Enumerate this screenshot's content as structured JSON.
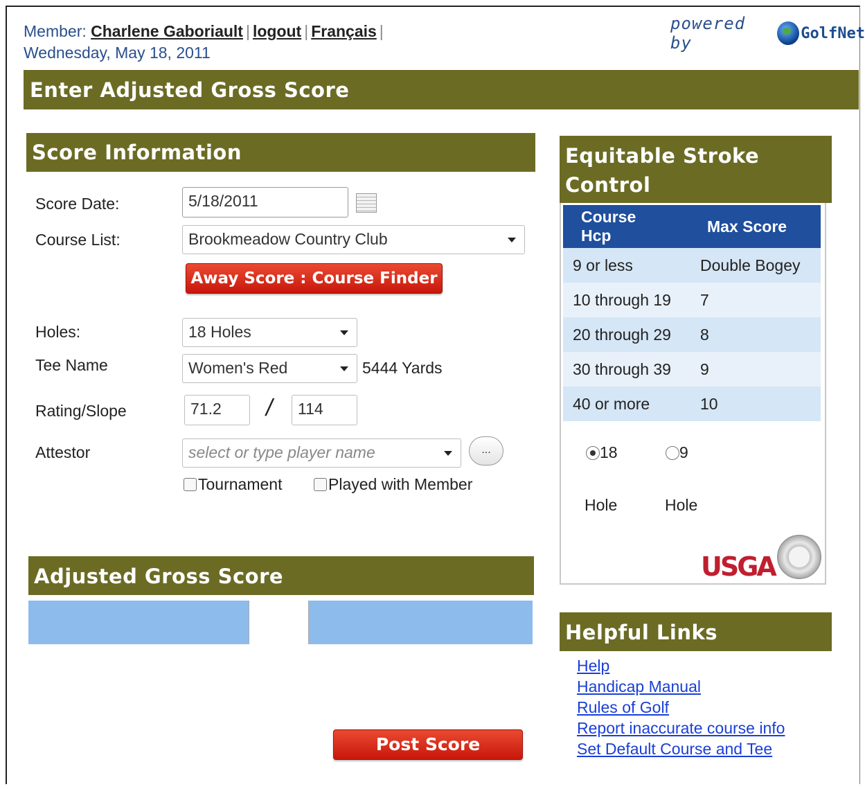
{
  "header": {
    "member_label": "Member:",
    "member_name": "Charlene Gaboriault",
    "logout": "logout",
    "language": "Français",
    "date": "Wednesday, May 18, 2011",
    "powered_by": "powered by",
    "brand": "GolfNet"
  },
  "page_title": "Enter Adjusted Gross Score",
  "score_info": {
    "title": "Score Information",
    "score_date_label": "Score Date:",
    "score_date_value": "5/18/2011",
    "course_list_label": "Course List:",
    "course_list_value": "Brookmeadow Country Club",
    "away_button": "Away Score : Course Finder",
    "holes_label": "Holes:",
    "holes_value": "18 Holes",
    "tee_label": "Tee Name",
    "tee_value": "Women's Red",
    "yards": "5444 Yards",
    "rating_label": "Rating/Slope",
    "rating_value": "71.2",
    "slash": "/",
    "slope_value": "114",
    "attestor_label": "Attestor",
    "attestor_placeholder": "select or type player name",
    "attestor_more": "...",
    "tournament_label": "Tournament",
    "played_with_label": "Played with Member"
  },
  "ags": {
    "title": "Adjusted Gross Score",
    "value": ""
  },
  "post_button": "Post Score",
  "esc": {
    "title_line1": "Equitable Stroke",
    "title_line2": "Control",
    "col1_line1": "Course",
    "col1_line2": "Hcp",
    "col2": "Max Score",
    "rows": [
      {
        "hcp": "9 or less",
        "max": "Double Bogey"
      },
      {
        "hcp": "10 through 19",
        "max": "7"
      },
      {
        "hcp": "20 through 29",
        "max": "8"
      },
      {
        "hcp": "30 through 39",
        "max": "9"
      },
      {
        "hcp": "40 or more",
        "max": "10"
      }
    ],
    "radio_18": "18",
    "radio_9": "9",
    "hole_label_a": "Hole",
    "hole_label_b": "Hole",
    "logo_text": "USGA"
  },
  "helpful": {
    "title": "Helpful Links",
    "links": [
      "Help",
      "Handicap Manual",
      "Rules of Golf",
      "Report inaccurate course info",
      "Set Default Course and Tee"
    ]
  },
  "colors": {
    "olive_bar": "#6b6b24",
    "table_header": "#1f4f9d",
    "link": "#1a3fd6",
    "red_button": "#d42812",
    "ags_band": "#8dbbeb"
  }
}
